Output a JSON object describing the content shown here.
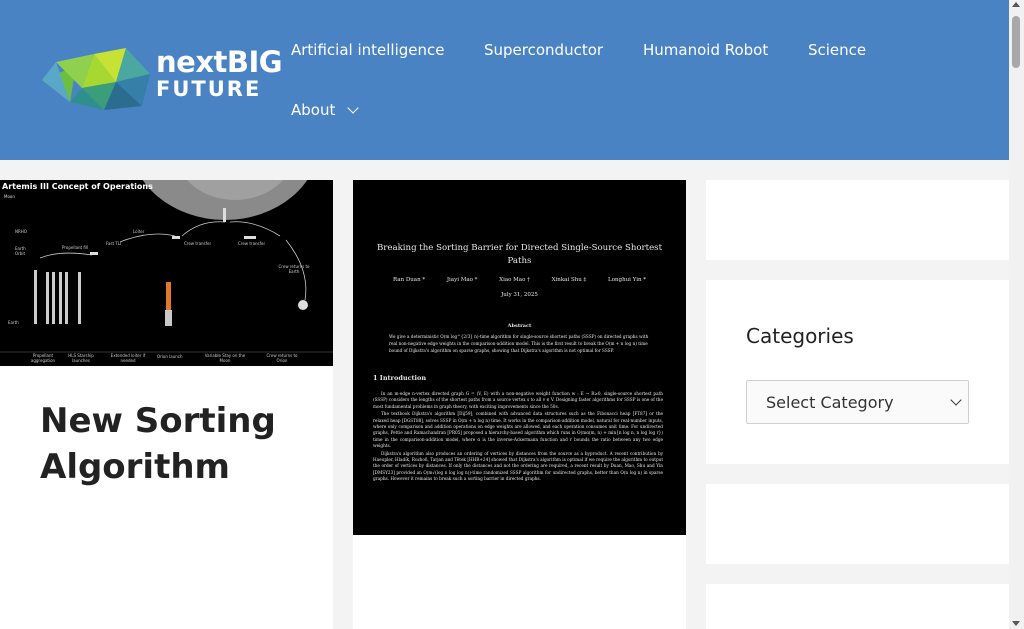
{
  "header": {
    "logo_line1": "nextBIG",
    "logo_line2": "FUTURE",
    "nav": [
      {
        "label": "Artificial intelligence"
      },
      {
        "label": "Superconductor"
      },
      {
        "label": "Humanoid Robot"
      },
      {
        "label": "Science"
      },
      {
        "label": "About"
      }
    ]
  },
  "posts": {
    "left": {
      "image": {
        "title": "Artemis III Concept of Operations",
        "moon_label": "Moon",
        "labels": [
          "NRHO",
          "Earth Orbit",
          "Earth",
          "Propellant fill",
          "Loiter",
          "Fast TLI",
          "Crew transfer",
          "Crew transfer",
          "Crew returns to Earth",
          "Propellant aggregation",
          "HLS Starship launches",
          "Extended loiter if needed",
          "Orion launch",
          "Variable Stay on the Moon",
          "Crew returns to Orion"
        ]
      }
    },
    "middle": {
      "image": {
        "paper_title": "Breaking the Sorting Barrier for Directed Single-Source Shortest Paths",
        "authors": [
          "Ran Duan *",
          "Jiayi Mao *",
          "Xiao Mao †",
          "Xinkai Shu ‡",
          "Longhui Yin *"
        ],
        "date": "July 31, 2025",
        "abstract_heading": "Abstract",
        "abstract": "We give a deterministic O(m log^{2/3} n)-time algorithm for single-source shortest paths (SSSP) on directed graphs with real non-negative edge weights in the comparison-addition model. This is the first result to break the O(m + n log n) time bound of Dijkstra's algorithm on sparse graphs, showing that Dijkstra's algorithm is not optimal for SSSP.",
        "intro_heading": "1   Introduction",
        "body": [
          "In an m-edge n-vertex directed graph G = (V, E) with a non-negative weight function w : E → R≥0, single-source shortest path (SSSP) considers the lengths of the shortest paths from a source vertex s to all v ∈ V. Designing faster algorithms for SSSP is one of the most fundamental problems in graph theory, with exciting improvements since the 50s.",
          "The textbook Dijkstra's algorithm [Dij59], combined with advanced data structures such as the Fibonacci heap [FT87] or the relaxed heap [DGST88], solves SSSP in O(m + n log n) time. It works in the comparison-addition model, natural for real-number inputs, where only comparison and addition operations on edge weights are allowed, and each operation consumes unit time. For undirected graphs, Pettie and Ramachandran [PR05] proposed a hierarchy-based algorithm which runs in O(mα(m, n) + min{n log n, n log log r}) time in the comparison-addition model, where α is the inverse-Ackermann function and r bounds the ratio between any two edge weights.",
          "Dijkstra's algorithm also produces an ordering of vertices by distances from the source as a byproduct. A recent contribution by Haeupler, Hladík, Rozhoň, Tarjan and Tětek [HHR+24] showed that Dijkstra's algorithm is optimal if we require the algorithm to output the order of vertices by distances. If only the distances and not the ordering are required, a recent result by Duan, Mao, Shu and Yin [DMSY23] provided an O(m√(log n log log n))-time randomized SSSP algorithm for undirected graphs, better than O(n log n) in sparse graphs. However it remains to break such a sorting barrier in directed graphs."
        ]
      },
      "title": "New Sorting Algorithm"
    }
  },
  "sidebar": {
    "categories_title": "Categories",
    "categories_select": "Select Category"
  }
}
